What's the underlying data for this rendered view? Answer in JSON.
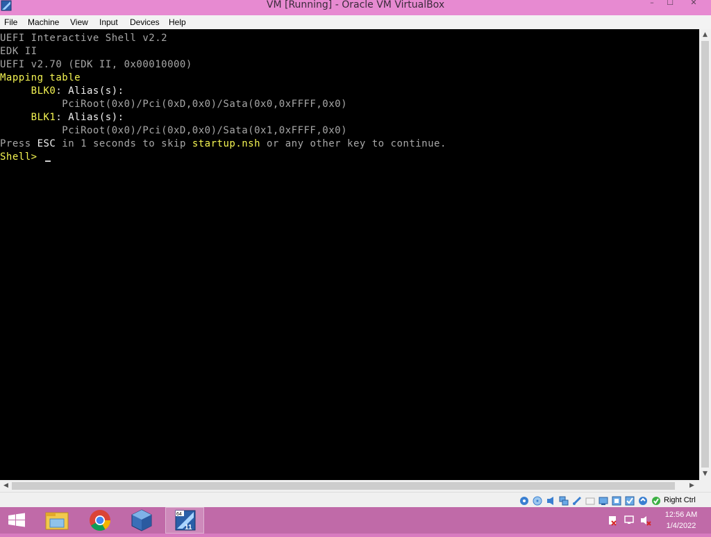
{
  "window": {
    "title": "VM [Running] - Oracle VM VirtualBox",
    "minimize_glyph": "–",
    "maximize_glyph": "☐",
    "close_glyph": "✕"
  },
  "menu": {
    "items": [
      "File",
      "Machine",
      "View",
      "Input",
      "Devices",
      "Help"
    ]
  },
  "console": {
    "lines": [
      {
        "segments": [
          {
            "text": "UEFI Interactive Shell v2.2",
            "color": "grey"
          }
        ]
      },
      {
        "segments": [
          {
            "text": "EDK II",
            "color": "grey"
          }
        ]
      },
      {
        "segments": [
          {
            "text": "UEFI v2.70 (EDK II, 0x00010000)",
            "color": "grey"
          }
        ]
      },
      {
        "segments": [
          {
            "text": "Mapping table",
            "color": "yellow"
          }
        ]
      },
      {
        "segments": [
          {
            "text": "     BLK0",
            "color": "yellow"
          },
          {
            "text": ": Alias(s):",
            "color": "white"
          }
        ]
      },
      {
        "segments": [
          {
            "text": "          PciRoot(0x0)/Pci(0xD,0x0)/Sata(0x0,0xFFFF,0x0)",
            "color": "grey"
          }
        ]
      },
      {
        "segments": [
          {
            "text": "     BLK1",
            "color": "yellow"
          },
          {
            "text": ": Alias(s):",
            "color": "white"
          }
        ]
      },
      {
        "segments": [
          {
            "text": "          PciRoot(0x0)/Pci(0xD,0x0)/Sata(0x1,0xFFFF,0x0)",
            "color": "grey"
          }
        ]
      },
      {
        "segments": [
          {
            "text": "Press ",
            "color": "grey"
          },
          {
            "text": "ESC",
            "color": "white"
          },
          {
            "text": " in 1 seconds to skip ",
            "color": "grey"
          },
          {
            "text": "startup.nsh",
            "color": "yellow"
          },
          {
            "text": " or any other key to continue.",
            "color": "grey"
          }
        ]
      },
      {
        "segments": [
          {
            "text": "Shell> ",
            "color": "yellow"
          }
        ],
        "cursor": true
      }
    ]
  },
  "statusbar": {
    "icons": [
      "hard-disk-icon",
      "optical-drive-icon",
      "audio-icon",
      "network-icon",
      "usb-icon",
      "shared-folders-icon",
      "display-icon",
      "recording-icon",
      "vm-state-icon",
      "cpu-icon",
      "mouse-integration-icon"
    ],
    "host_key": "Right Ctrl"
  },
  "taskbar": {
    "apps": [
      {
        "name": "file-explorer-icon",
        "active": false
      },
      {
        "name": "chrome-icon",
        "active": false
      },
      {
        "name": "virtualbox-icon",
        "active": false
      },
      {
        "name": "vm-window-icon",
        "active": true,
        "badge_top": "64",
        "badge_bottom": "11"
      }
    ],
    "tray_icons": [
      "action-center-icon",
      "network-tray-icon",
      "volume-muted-icon"
    ],
    "time": "12:56 AM",
    "date": "1/4/2022"
  },
  "colors": {
    "titlebar": "#e78ad1",
    "taskbar": "#c06aa8",
    "console_bg": "#000000",
    "console_grey": "#a8a8a8",
    "console_yellow": "#f5f552",
    "console_white": "#f2f2f2"
  }
}
